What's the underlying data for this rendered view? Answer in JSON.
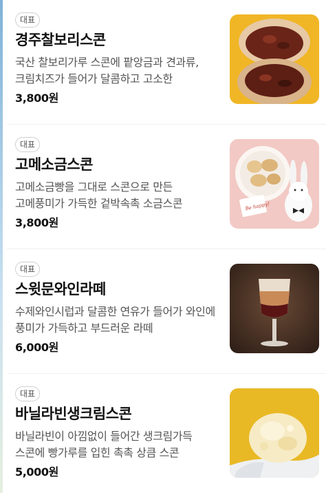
{
  "menu": {
    "items": [
      {
        "badge": "대표",
        "name": "경주찰보리스콘",
        "description": "국산 찰보리가루 스콘에 팥앙금과 견과류, 크림치즈가 들어가 달콤하고 고소한",
        "price": "3,800원",
        "image": "barley-scone-photo"
      },
      {
        "badge": "대표",
        "name": "고메소금스콘",
        "description": "고메소금빵을 그대로 스콘으로 만든 고메풍미가 가득한 겉박속촉 소금스콘",
        "price": "3,800원",
        "image": "salt-scone-photo",
        "image_text": "Be happy!"
      },
      {
        "badge": "대표",
        "name": "스윗문와인라떼",
        "description": "수제와인시럽과 달콤한 연유가 들어가 와인에 풍미가 가득하고 부드러운 라떼",
        "price": "6,000원",
        "image": "wine-latte-photo"
      },
      {
        "badge": "대표",
        "name": "바닐라빈생크림스콘",
        "description": "바닐라빈이 아낌없이 들어간 생크림가득 스콘에 빵가루를 입힌 촉촉 상큼 스콘",
        "price": "5,000원",
        "image": "vanilla-cream-scone-photo"
      }
    ]
  }
}
